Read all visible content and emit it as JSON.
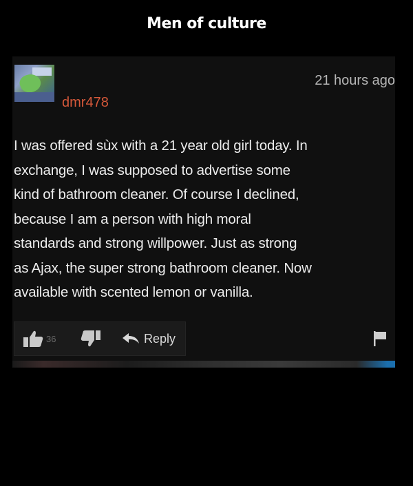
{
  "caption": "Men of culture",
  "post": {
    "username": "dmr478",
    "timestamp": "21 hours ago",
    "comment": "I was offered sùx with a 21 year old girl today. In exchange, I was supposed to advertise some kind of bathroom cleaner. Of course I declined, because I am a person with high moral standards and strong willpower. Just as strong as Ajax, the super strong bathroom cleaner. Now available with scented lemon or vanilla.",
    "comment_lines": [
      "I was offered sùx with a 21 year old girl today. In",
      "exchange, I was supposed to advertise some",
      "kind of bathroom cleaner. Of course I declined,",
      "because I am a person with high moral",
      "standards and strong willpower. Just as strong",
      "as Ajax, the super strong bathroom cleaner. Now",
      "available with scented lemon or vanilla."
    ],
    "like_count": "36",
    "reply_label": "Reply"
  },
  "icons": {
    "like": "thumbs-up-icon",
    "dislike": "thumbs-down-icon",
    "reply": "reply-arrow-icon",
    "flag": "flag-icon",
    "avatar": "user-avatar"
  },
  "colors": {
    "background": "#000000",
    "card": "#101010",
    "username": "#d5583a",
    "text": "#ececec",
    "timestamp": "#b6b6b6"
  }
}
